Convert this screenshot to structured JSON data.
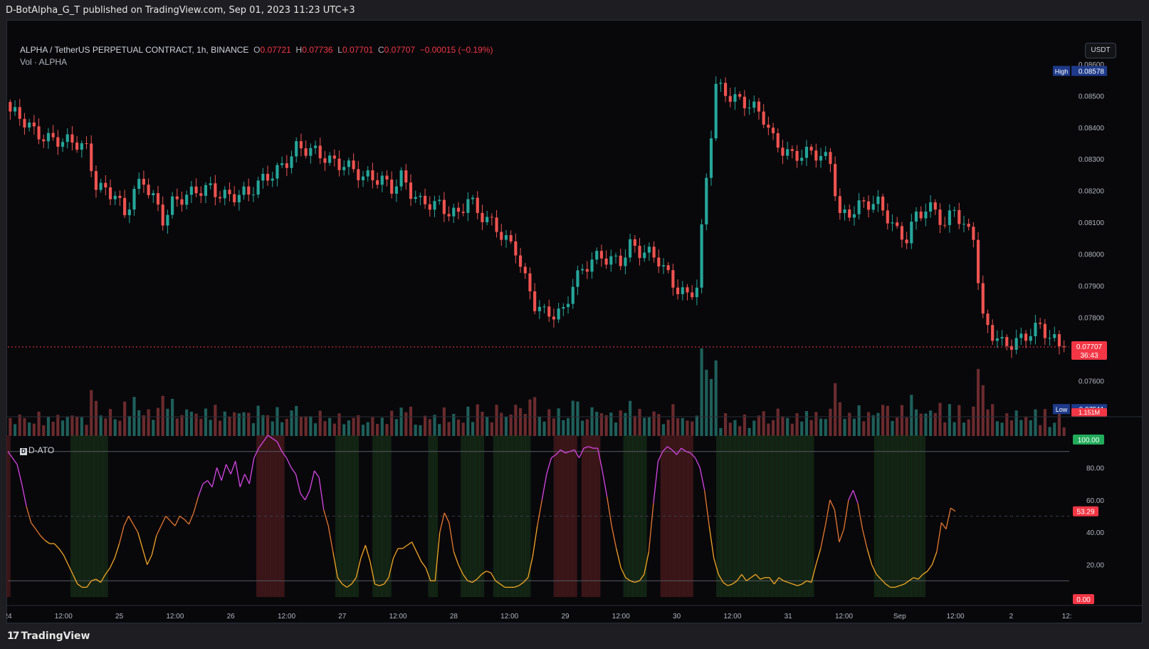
{
  "header": {
    "published": "D-BotAlpha_G_T published on TradingView.com, Sep 01, 2023 11:23 UTC+3"
  },
  "legend": {
    "symbol": "ALPHA / TetherUS PERPETUAL CONTRACT, 1h, BINANCE",
    "o_label": "O",
    "o": "0.07721",
    "h_label": "H",
    "h": "0.07736",
    "l_label": "L",
    "l": "0.07701",
    "c_label": "C",
    "c": "0.07707",
    "change": "−0.00015 (−0.19%)",
    "volume": "Vol · ALPHA"
  },
  "currency_button": "USDT",
  "indicator_legend": "D-ATO",
  "footer": {
    "brand": "TradingView"
  },
  "colors": {
    "up": "#26a69a",
    "down": "#ef5350",
    "background": "#08080b",
    "osc_low": "#f6a623",
    "osc_high": "#d845e6",
    "zone_green": "#1c3a1e",
    "zone_red": "#4a1a1d"
  },
  "chart_data": [
    {
      "type": "candlestick",
      "title": "ALPHA / TetherUS PERPETUAL CONTRACT, 1h, BINANCE",
      "x_ticks": [
        "24",
        "12:00",
        "25",
        "12:00",
        "26",
        "12:00",
        "27",
        "12:00",
        "28",
        "12:00",
        "29",
        "12:00",
        "30",
        "12:00",
        "31",
        "12:00",
        "Sep",
        "12:00",
        "2",
        "12:"
      ],
      "y_ticks": [
        "0.08600",
        "0.08500",
        "0.08400",
        "0.08300",
        "0.08200",
        "0.08100",
        "0.08000",
        "0.07900",
        "0.07800",
        "0.07600"
      ],
      "ylim": [
        0.0748,
        0.0864
      ],
      "high_label": "High",
      "high": "0.08578",
      "low_label": "Low",
      "low": "0.07511",
      "last_price": "0.07707",
      "countdown": "36:43",
      "volume_label": "1.151M",
      "anchors": [
        [
          0,
          0.0845
        ],
        [
          5,
          0.0838
        ],
        [
          10,
          0.0837
        ],
        [
          14,
          0.0834
        ],
        [
          16,
          0.0832
        ],
        [
          18,
          0.0822
        ],
        [
          22,
          0.082
        ],
        [
          24,
          0.0812
        ],
        [
          26,
          0.0819
        ],
        [
          28,
          0.0822
        ],
        [
          30,
          0.0818
        ],
        [
          32,
          0.0812
        ],
        [
          34,
          0.0817
        ],
        [
          38,
          0.0818
        ],
        [
          42,
          0.0821
        ],
        [
          46,
          0.0819
        ],
        [
          50,
          0.0818
        ],
        [
          54,
          0.0825
        ],
        [
          58,
          0.083
        ],
        [
          60,
          0.0833
        ],
        [
          62,
          0.0832
        ],
        [
          66,
          0.0831
        ],
        [
          70,
          0.0829
        ],
        [
          74,
          0.0823
        ],
        [
          78,
          0.0824
        ],
        [
          80,
          0.0822
        ],
        [
          82,
          0.0825
        ],
        [
          84,
          0.0819
        ],
        [
          86,
          0.0815
        ],
        [
          90,
          0.0816
        ],
        [
          94,
          0.0813
        ],
        [
          96,
          0.0817
        ],
        [
          98,
          0.0812
        ],
        [
          102,
          0.0809
        ],
        [
          106,
          0.0802
        ],
        [
          108,
          0.0791
        ],
        [
          110,
          0.0783
        ],
        [
          112,
          0.0781
        ],
        [
          116,
          0.0783
        ],
        [
          118,
          0.0791
        ],
        [
          122,
          0.0797
        ],
        [
          124,
          0.0799
        ],
        [
          128,
          0.0799
        ],
        [
          130,
          0.0803
        ],
        [
          132,
          0.08
        ],
        [
          136,
          0.0798
        ],
        [
          140,
          0.079
        ],
        [
          142,
          0.0787
        ],
        [
          144,
          0.0789
        ],
        [
          146,
          0.0823
        ],
        [
          148,
          0.0853
        ],
        [
          150,
          0.0852
        ],
        [
          154,
          0.0848
        ],
        [
          158,
          0.0842
        ],
        [
          160,
          0.0836
        ],
        [
          164,
          0.0832
        ],
        [
          168,
          0.0831
        ],
        [
          172,
          0.0829
        ],
        [
          174,
          0.0813
        ],
        [
          178,
          0.0815
        ],
        [
          182,
          0.0815
        ],
        [
          184,
          0.0812
        ],
        [
          186,
          0.0808
        ],
        [
          188,
          0.0806
        ],
        [
          190,
          0.0812
        ],
        [
          192,
          0.0813
        ],
        [
          194,
          0.0813
        ],
        [
          196,
          0.0809
        ],
        [
          198,
          0.0816
        ],
        [
          200,
          0.0809
        ],
        [
          202,
          0.0806
        ],
        [
          203,
          0.0791
        ],
        [
          204,
          0.0778
        ],
        [
          206,
          0.0774
        ],
        [
          208,
          0.0772
        ],
        [
          212,
          0.0774
        ],
        [
          216,
          0.0776
        ],
        [
          218,
          0.0773
        ],
        [
          221,
          0.0771
        ]
      ]
    },
    {
      "type": "line",
      "title": "D-ATO",
      "y_ticks": [
        "100.00",
        "80.00",
        "60.00",
        "40.00",
        "20.00",
        "0.00"
      ],
      "ylim": [
        0,
        100
      ],
      "last_value": "53.29",
      "min_value": "0.00",
      "max_value": "100.00",
      "values": [
        90,
        86,
        82,
        70,
        56,
        46,
        42,
        38,
        35,
        33,
        33,
        30,
        26,
        20,
        14,
        8,
        6,
        6,
        10,
        11,
        9,
        14,
        18,
        24,
        33,
        44,
        50,
        45,
        40,
        30,
        20,
        26,
        38,
        44,
        50,
        47,
        44,
        50,
        48,
        45,
        52,
        62,
        70,
        72,
        68,
        80,
        72,
        82,
        76,
        84,
        68,
        76,
        70,
        86,
        92,
        96,
        100,
        98,
        96,
        90,
        86,
        80,
        76,
        64,
        60,
        66,
        78,
        74,
        54,
        44,
        28,
        12,
        8,
        6,
        8,
        12,
        24,
        32,
        22,
        8,
        7,
        8,
        12,
        24,
        30,
        30,
        32,
        34,
        28,
        22,
        18,
        10,
        10,
        40,
        52,
        46,
        28,
        20,
        14,
        10,
        9,
        11,
        14,
        16,
        15,
        10,
        8,
        6,
        6,
        6,
        7,
        9,
        12,
        25,
        44,
        60,
        76,
        86,
        88,
        91,
        89,
        90,
        91,
        86,
        92,
        93,
        92,
        92,
        78,
        62,
        44,
        30,
        18,
        12,
        10,
        9,
        10,
        14,
        28,
        58,
        84,
        90,
        93,
        91,
        88,
        92,
        90,
        89,
        86,
        80,
        66,
        44,
        24,
        14,
        9,
        7,
        8,
        10,
        14,
        10,
        12,
        14,
        11,
        12,
        12,
        8,
        12,
        10,
        9,
        8,
        7,
        8,
        10,
        9,
        20,
        30,
        44,
        60,
        54,
        34,
        42,
        60,
        66,
        58,
        42,
        30,
        20,
        14,
        11,
        8,
        6,
        6,
        7,
        8,
        10,
        12,
        11,
        14,
        16,
        20,
        28,
        46,
        42,
        55,
        53
      ]
    }
  ]
}
